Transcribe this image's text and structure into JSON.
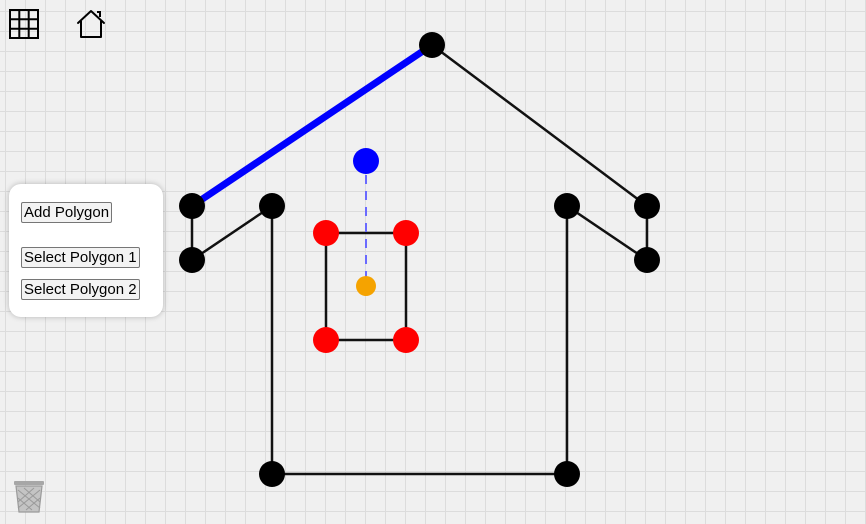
{
  "toolbar": {
    "grid_icon": "grid-icon",
    "home_icon": "home-icon",
    "trash_icon": "trash-icon"
  },
  "panel": {
    "add_polygon": "Add Polygon",
    "select_polygon_1": "Select Polygon 1",
    "select_polygon_2": "Select Polygon 2"
  },
  "colors": {
    "vertex": "#000000",
    "selected_vertex": "#ff0000",
    "selected_edge": "#0000ff",
    "rotation_handle": "#0000ff",
    "center_point": "#f5a300"
  }
}
